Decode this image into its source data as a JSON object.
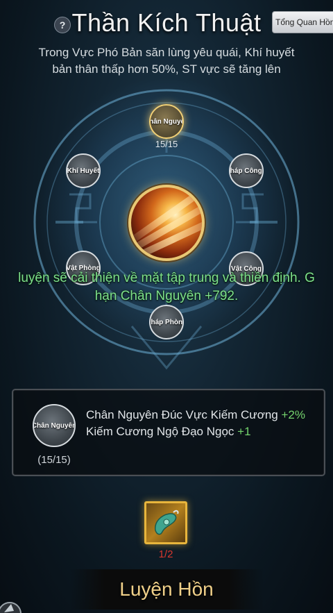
{
  "header": {
    "help_icon": "?",
    "title": "Thần Kích Thuật",
    "overview_button": "Tổng Quan Hồn"
  },
  "description": [
    "Trong Vực Phó Bản săn lùng yêu quái, Khí huyết",
    "bản thân thấp hơn 50%, ST vực sẽ tăng lên"
  ],
  "wheel": {
    "nodes": [
      {
        "label": "Chân Nguyên",
        "active": true
      },
      {
        "label": "Pháp CôngK",
        "active": false
      },
      {
        "label": "Vật Công",
        "active": false
      },
      {
        "label": "Pháp Phòng",
        "active": false
      },
      {
        "label": "Vật Phòng",
        "active": false
      },
      {
        "label": "Khí Huyết",
        "active": false
      }
    ],
    "active_count": "15/15",
    "center_icon": "flame-slash-skill-icon"
  },
  "toast": {
    "line1": "luyện sẽ cải thiện về mặt tập trung và thiền định. G",
    "line2": "hạn Chân Nguyên +792."
  },
  "panel": {
    "node_label": "Chân Nguyên",
    "count": "(15/15)",
    "bonuses": [
      {
        "name": "Chân Nguyên Đúc Vực Kiếm Cương",
        "value": "+2%"
      },
      {
        "name": "Kiếm Cương Ngộ Đạo Ngọc",
        "value": "+1"
      }
    ]
  },
  "material": {
    "icon": "jade-pendant-icon",
    "count": "1/2"
  },
  "action_button": "Luyện Hồn",
  "colors": {
    "gold_accent": "#e9c774",
    "bonus_green": "#74d36d",
    "toast_green": "#7de08a",
    "insufficient_red": "#d7372e"
  }
}
